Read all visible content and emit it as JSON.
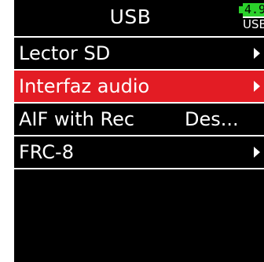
{
  "header": {
    "title": "USB",
    "battery_level": "4.9",
    "power_source": "USB",
    "battery_color": "#2bd12b"
  },
  "menu": {
    "selected_color": "#e31c24",
    "items": [
      {
        "label": "Lector SD",
        "value": "",
        "icon": "chevron-right-icon"
      },
      {
        "label": "Interfaz audio",
        "value": "",
        "icon": "chevron-right-icon",
        "selected": true
      },
      {
        "label": "AIF with Rec",
        "value": "Des...",
        "icon": ""
      },
      {
        "label": "FRC-8",
        "value": "",
        "icon": "chevron-right-icon"
      }
    ]
  }
}
